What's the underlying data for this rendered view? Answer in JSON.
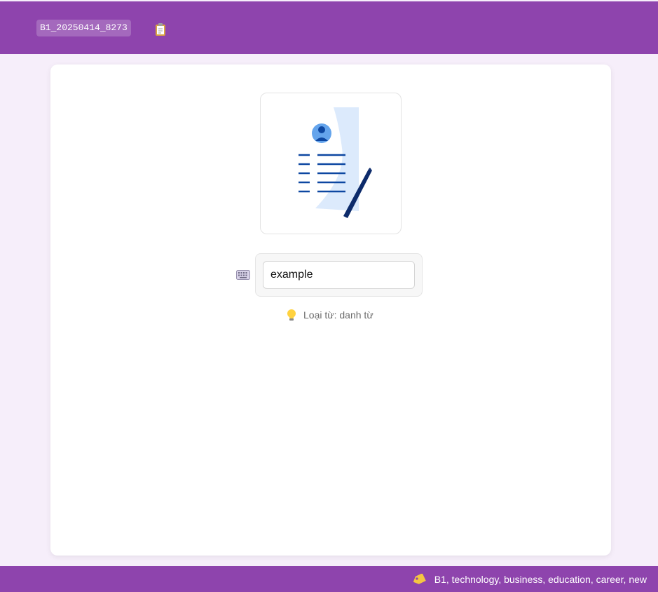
{
  "header": {
    "code": "B1_20250414_8273",
    "clipboard_icon": "clipboard-icon"
  },
  "card": {
    "image_icon": "resume-document-with-pen-illustration",
    "keyboard_icon": "keyboard-icon",
    "answer": {
      "value": "example",
      "placeholder": ""
    },
    "hint_icon": "lightbulb-icon",
    "hint_text": "Loại từ: danh từ"
  },
  "footer": {
    "tag_icon": "tag-icon",
    "tags_text": "B1, technology, business, education, career, new"
  },
  "colors": {
    "brand": "#8e44ad",
    "background": "#f6eefa",
    "card": "#ffffff",
    "illustration_blue": "#0d47a1"
  }
}
